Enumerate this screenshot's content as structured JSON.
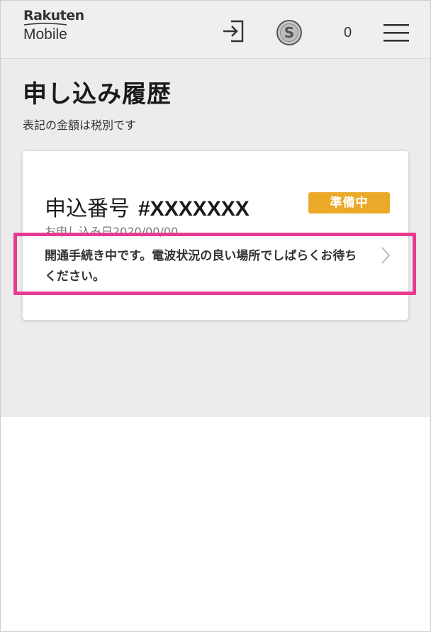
{
  "header": {
    "logo_top": "Rakuten",
    "logo_bottom": "Mobile",
    "points_count": "0"
  },
  "page": {
    "title": "申し込み履歴",
    "note": "表記の金額は税別です"
  },
  "order_card": {
    "order_label": "申込番号",
    "order_number": "#XXXXXXX",
    "status": "準備中",
    "date": "お申し込み日2020/00/00",
    "message": "開通手続き中です。電波状況の良い場所でしばらくお待ちください。"
  },
  "colors": {
    "status_badge": "#eba929",
    "highlight": "#e83a8f",
    "logo_accent": "#bf0000"
  },
  "icons": {
    "login": "login-icon",
    "coin": "super-points-icon",
    "menu": "hamburger-menu-icon",
    "chevron": "chevron-right-icon"
  }
}
